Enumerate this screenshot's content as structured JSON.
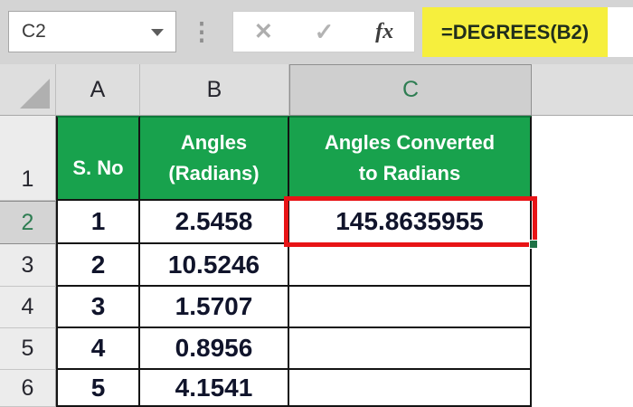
{
  "formula_bar": {
    "name_box": "C2",
    "formula": "=DEGREES(B2)"
  },
  "icons": {
    "cancel": "✕",
    "enter": "✓",
    "fx": "fx",
    "dots": "⋮"
  },
  "sheet": {
    "column_headers": [
      "A",
      "B",
      "C"
    ],
    "row_headers": [
      "1",
      "2",
      "3",
      "4",
      "5",
      "6"
    ],
    "header_row": {
      "a": "S. No",
      "b": "Angles\n(Radians)",
      "c": "Angles Converted\nto Radians"
    },
    "rows": [
      {
        "a": "1",
        "b": "2.5458",
        "c": "145.8635955"
      },
      {
        "a": "2",
        "b": "10.5246",
        "c": ""
      },
      {
        "a": "3",
        "b": "1.5707",
        "c": ""
      },
      {
        "a": "4",
        "b": "0.8956",
        "c": ""
      },
      {
        "a": "5",
        "b": "4.1541",
        "c": ""
      }
    ]
  },
  "colors": {
    "header_green": "#18a24d",
    "formula_highlight": "#f6ef3d",
    "annotation_red": "#e81416",
    "selected_header_text": "#2e7d52"
  }
}
